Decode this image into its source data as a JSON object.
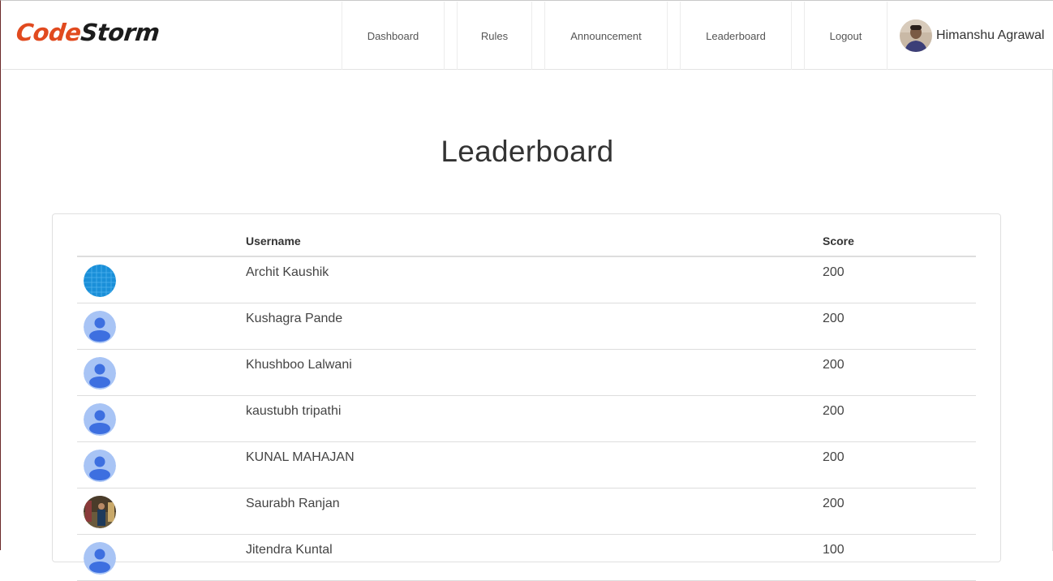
{
  "brand": {
    "part1": "Code",
    "part2": "Storm",
    "color_primary": "#e14a1f",
    "color_secondary": "#1c1c1c"
  },
  "nav": {
    "dashboard": "Dashboard",
    "rules": "Rules",
    "announcement": "Announcement",
    "leaderboard": "Leaderboard",
    "logout": "Logout"
  },
  "user": {
    "name": "Himanshu Agrawal",
    "avatar": "user-photo"
  },
  "page": {
    "title": "Leaderboard"
  },
  "table": {
    "headers": {
      "avatar": "",
      "username": "Username",
      "score": "Score"
    },
    "rows": [
      {
        "avatar": "globe-avatar",
        "name": "Archit Kaushik",
        "score": "200"
      },
      {
        "avatar": "default-person-avatar",
        "name": "Kushagra Pande",
        "score": "200"
      },
      {
        "avatar": "default-person-avatar",
        "name": "Khushboo Lalwani",
        "score": "200"
      },
      {
        "avatar": "default-person-avatar",
        "name": "kaustubh tripathi",
        "score": "200"
      },
      {
        "avatar": "default-person-avatar",
        "name": "KUNAL MAHAJAN",
        "score": "200"
      },
      {
        "avatar": "photo-avatar",
        "name": "Saurabh Ranjan",
        "score": "200"
      },
      {
        "avatar": "default-person-avatar",
        "name": "Jitendra Kuntal",
        "score": "100"
      }
    ]
  },
  "colors": {
    "default_avatar_bg": "#a8c4f5",
    "default_avatar_fg": "#3d6fe0",
    "globe": "#1a8fd8"
  }
}
